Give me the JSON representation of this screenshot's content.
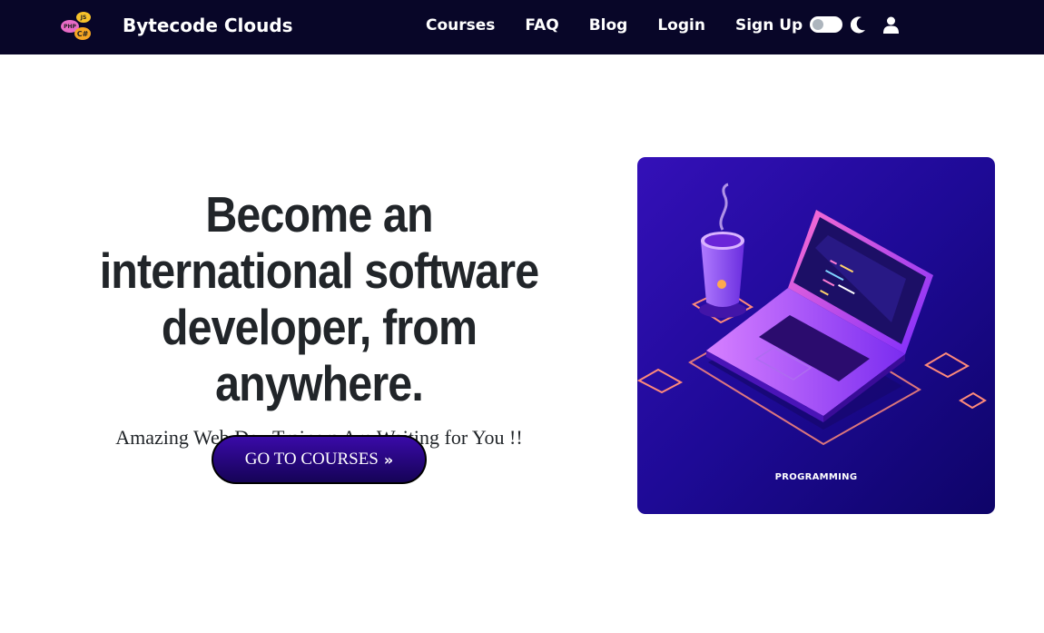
{
  "navbar": {
    "brand_name": "Bytecode Clouds",
    "logo_badges": [
      "PHP",
      "JS",
      "C#"
    ],
    "links": [
      "Courses",
      "FAQ",
      "Blog",
      "Login",
      "Sign Up"
    ],
    "theme_toggle_icon": "toggle-switch",
    "dark_mode_icon": "moon-icon",
    "profile_icon": "user-icon"
  },
  "hero": {
    "headline": "Become an international software developer, from anywhere.",
    "subline": "Amazing Web Dev Trainers Are Waiting for You !!",
    "cta_label": "GO TO COURSES",
    "cta_icon": "»"
  },
  "illustration": {
    "caption": "PROGRAMMING"
  },
  "colors": {
    "navbar_bg": "#080628",
    "accent": "#3a0aa8",
    "illustration_bg": "#1a0a8a",
    "text": "#212529"
  }
}
